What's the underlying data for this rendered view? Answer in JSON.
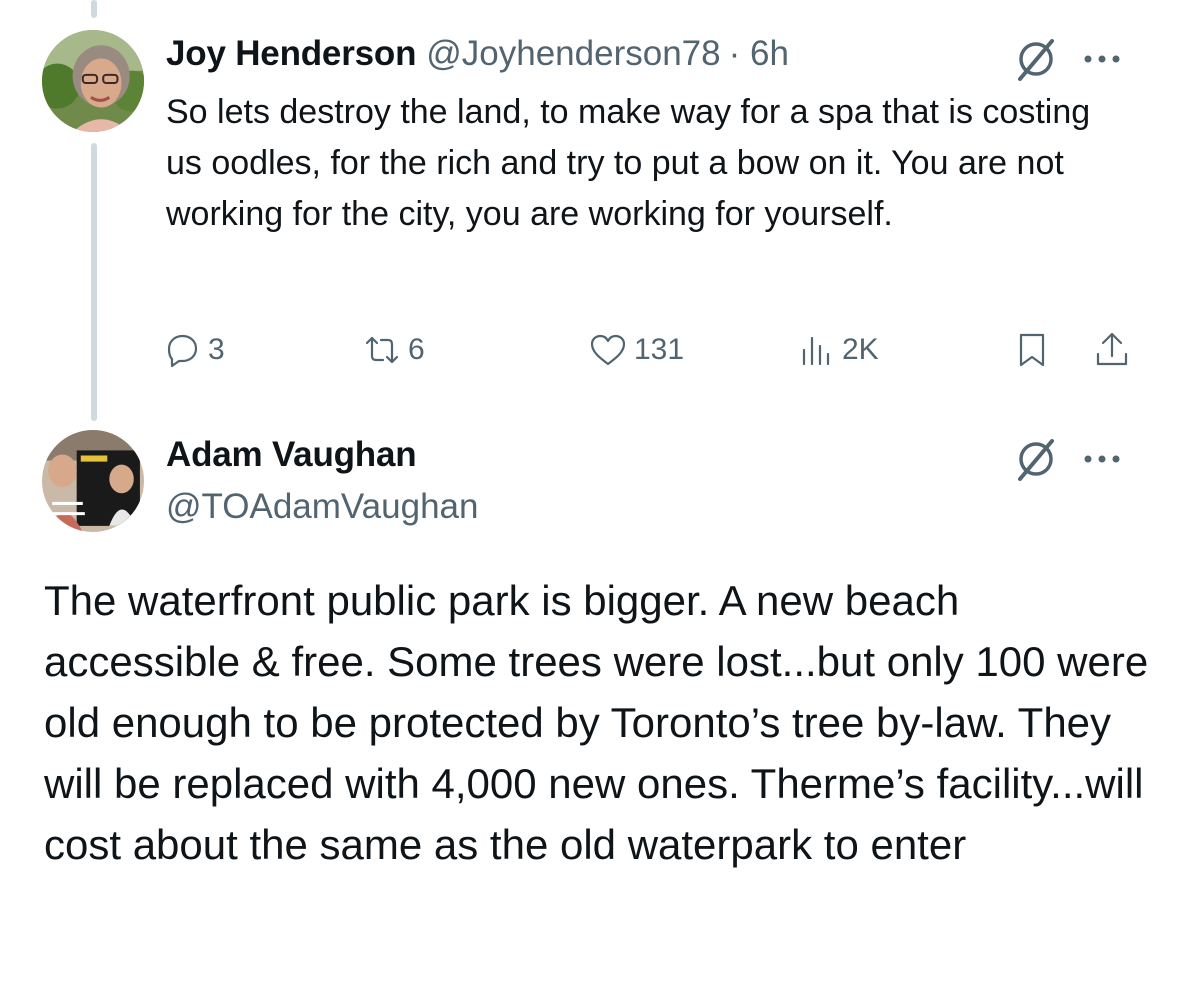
{
  "tweet1": {
    "author_name": "Joy Henderson",
    "handle": "@Joyhenderson78",
    "time": "· 6h",
    "text": "So lets destroy the land, to make way for a spa that is costing us oodles, for the rich and try to put a bow on it. You are not working for the city, you are working for yourself.",
    "stats": {
      "replies": "3",
      "reposts": "6",
      "likes": "131",
      "views": "2K"
    },
    "icons": [
      "reply-icon",
      "repost-icon",
      "like-icon",
      "views-icon",
      "bookmark-icon",
      "share-icon",
      "grok-icon",
      "more-icon"
    ]
  },
  "tweet2": {
    "author_name": "Adam Vaughan",
    "handle": "@TOAdamVaughan",
    "text": "The waterfront public park is bigger. A new beach accessible & free. Some trees were lost...but only 100 were old enough to be protected by Toronto’s tree by-law. They will be replaced with 4,000 new ones. Therme’s facility...will cost about the same as the old waterpark to enter",
    "icons": [
      "grok-icon",
      "more-icon"
    ]
  },
  "colors": {
    "text_primary": "#0f1419",
    "text_secondary": "#536471",
    "thread_line": "#cfd9de",
    "background": "#ffffff"
  }
}
